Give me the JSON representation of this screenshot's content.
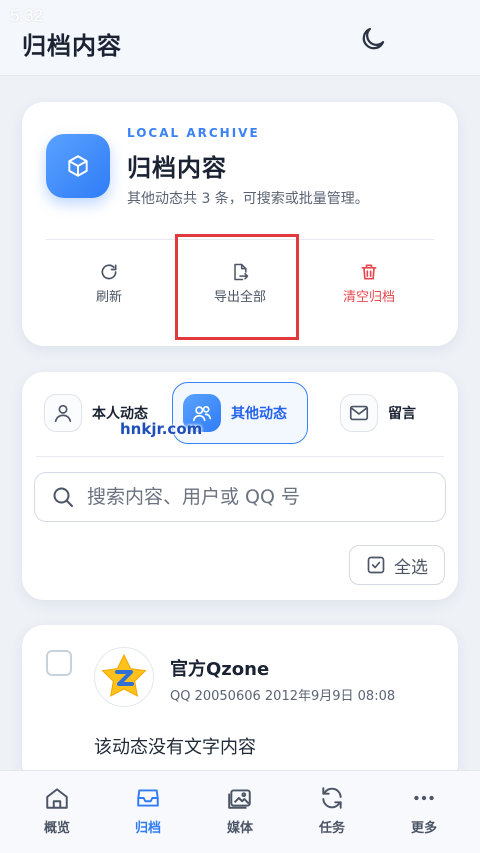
{
  "status_bar": {
    "time": "5:32"
  },
  "header": {
    "title": "归档内容"
  },
  "archive": {
    "eyebrow": "LOCAL ARCHIVE",
    "title": "归档内容",
    "description": "其他动态共 3 条，可搜索或批量管理。",
    "actions": {
      "refresh": "刷新",
      "export_all": "导出全部",
      "clear": "清空归档"
    }
  },
  "tabs": {
    "self": "本人动态",
    "other": "其他动态",
    "message": "留言"
  },
  "watermark": "hnkjr.com",
  "search": {
    "placeholder": "搜索内容、用户或 QQ 号",
    "value": ""
  },
  "select_all": "全选",
  "post": {
    "author": "官方Qzone",
    "meta": "QQ 20050606  2012年9月9日 08:08",
    "text": "该动态没有文字内容"
  },
  "bottom_nav": {
    "overview": "概览",
    "archive": "归档",
    "media": "媒体",
    "tasks": "任务",
    "more": "更多"
  },
  "colors": {
    "accent": "#2f7cf6",
    "danger": "#e5484d",
    "highlight": "#e0393e"
  },
  "icons": {
    "theme": "moon-icon",
    "logo": "cube-icon",
    "refresh": "refresh-icon",
    "export": "export-icon",
    "clear": "trash-icon",
    "self": "user-icon",
    "other": "users-icon",
    "message": "mail-icon",
    "search": "search-icon",
    "select_all": "checkbox-icon",
    "avatar": "qzone-star-logo"
  }
}
